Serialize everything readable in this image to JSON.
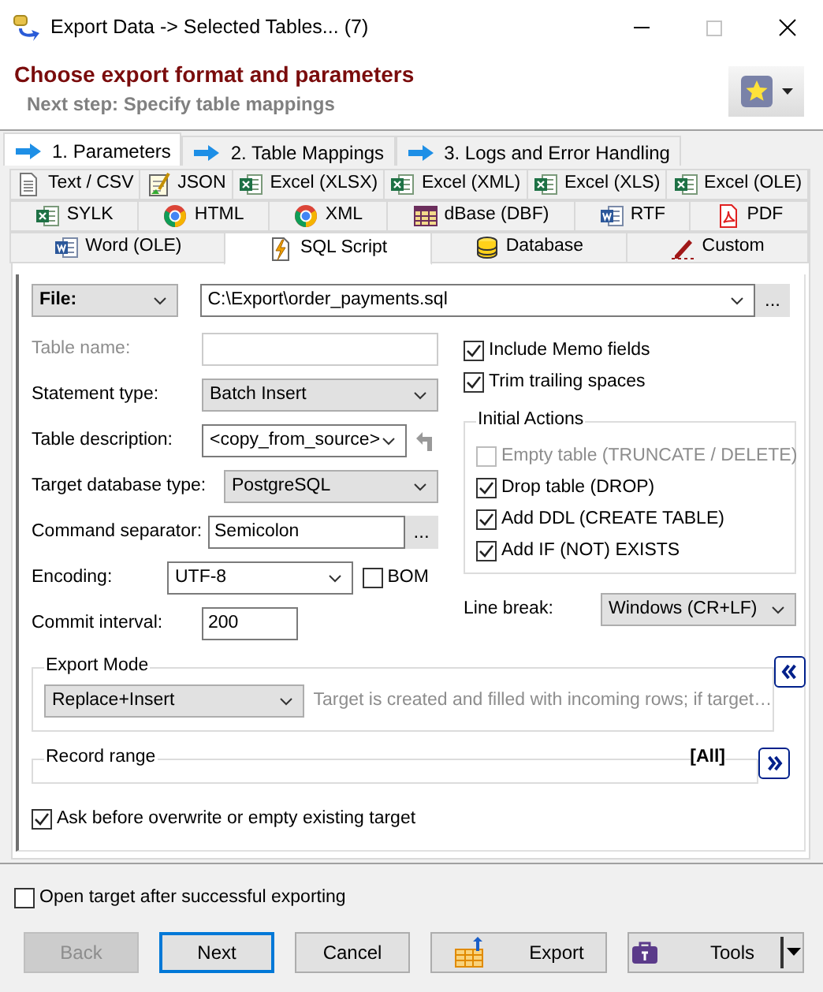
{
  "window": {
    "title": "Export Data -> Selected Tables... (7)"
  },
  "header": {
    "title": "Choose export format and parameters",
    "subtitle": "Next step: Specify table mappings"
  },
  "wizard_tabs": [
    {
      "label": "1. Parameters",
      "selected": true
    },
    {
      "label": "2. Table Mappings",
      "selected": false
    },
    {
      "label": "3. Logs and Error Handling",
      "selected": false
    }
  ],
  "format_tab_rows": [
    {
      "tabs": [
        {
          "label": "Text / CSV",
          "kind": "text",
          "selected": false
        },
        {
          "label": "JSON",
          "kind": "notepad",
          "selected": false
        },
        {
          "label": "Excel (XLSX)",
          "kind": "sheet",
          "selected": false
        },
        {
          "label": "Excel (XML)",
          "kind": "sheet",
          "selected": false
        },
        {
          "label": "Excel (XLS)",
          "kind": "sheet",
          "selected": false
        },
        {
          "label": "Excel (OLE)",
          "kind": "sheet",
          "selected": false
        }
      ]
    },
    {
      "tabs": [
        {
          "label": "SYLK",
          "kind": "sheet",
          "selected": false
        },
        {
          "label": "HTML",
          "kind": "web",
          "selected": false
        },
        {
          "label": "XML",
          "kind": "web",
          "selected": false
        },
        {
          "label": "dBase (DBF)",
          "kind": "grid",
          "selected": false
        },
        {
          "label": "RTF",
          "kind": "doc",
          "selected": false
        },
        {
          "label": "PDF",
          "kind": "pdf",
          "selected": false
        }
      ]
    },
    {
      "tabs": [
        {
          "label": "Word (OLE)",
          "kind": "doc",
          "selected": false
        },
        {
          "label": "SQL Script",
          "kind": "script",
          "selected": true
        },
        {
          "label": "Database",
          "kind": "database",
          "selected": false
        },
        {
          "label": "Custom",
          "kind": "pencil",
          "selected": false
        }
      ]
    }
  ],
  "file": {
    "mode": "File:",
    "path": "C:\\Export\\order_payments.sql",
    "browse": "..."
  },
  "fields": [
    {
      "label": "Table name:",
      "kind": "text",
      "disabled": true
    },
    {
      "label": "Statement type:",
      "kind": "combo",
      "value": "Batch Insert"
    },
    {
      "label": "Table description:",
      "kind": "combo-revert",
      "value": "<copy_from_source>"
    },
    {
      "label": "Target database type:",
      "kind": "combo",
      "value": "PostgreSQL"
    },
    {
      "label": "Command separator:",
      "kind": "browse",
      "value": "Semicolon",
      "browse": "..."
    },
    {
      "label": "Encoding:",
      "kind": "combo-check",
      "value": "UTF-8",
      "check": {
        "label": "BOM",
        "checked": false
      }
    },
    {
      "label": "Commit interval:",
      "kind": "short",
      "value": "200"
    }
  ],
  "options": [
    {
      "label": "Include Memo fields",
      "checked": true
    },
    {
      "label": "Trim trailing spaces",
      "checked": true
    }
  ],
  "initial_actions": {
    "title": "Initial Actions",
    "items": [
      {
        "label": "Empty table (TRUNCATE / DELETE)",
        "checked": false,
        "disabled": true
      },
      {
        "label": "Drop table (DROP)",
        "checked": true,
        "disabled": false
      },
      {
        "label": "Add DDL (CREATE TABLE)",
        "checked": true,
        "disabled": false
      },
      {
        "label": "Add IF (NOT) EXISTS",
        "checked": true,
        "disabled": false
      }
    ]
  },
  "line_break": {
    "label": "Line break:",
    "value": "Windows (CR+LF)"
  },
  "export_mode": {
    "title": "Export Mode",
    "value": "Replace+Insert",
    "description": "Target is created and filled with incoming rows; if target…",
    "expanded": true
  },
  "record_range": {
    "title": "Record range",
    "value": "[All]",
    "expanded": false
  },
  "ask_overwrite": {
    "label": "Ask before overwrite or empty existing target",
    "checked": true
  },
  "open_target": {
    "label": "Open target after successful exporting",
    "checked": false
  },
  "buttons": [
    {
      "label": "Back",
      "kind": "plain",
      "disabled": true,
      "default": false
    },
    {
      "label": "Next",
      "kind": "plain",
      "disabled": false,
      "default": true
    },
    {
      "label": "Cancel",
      "kind": "plain",
      "disabled": false,
      "default": false
    },
    {
      "label": "Export",
      "kind": "export",
      "disabled": false,
      "default": false
    },
    {
      "label": "Tools",
      "kind": "tools",
      "disabled": false,
      "default": false
    }
  ]
}
